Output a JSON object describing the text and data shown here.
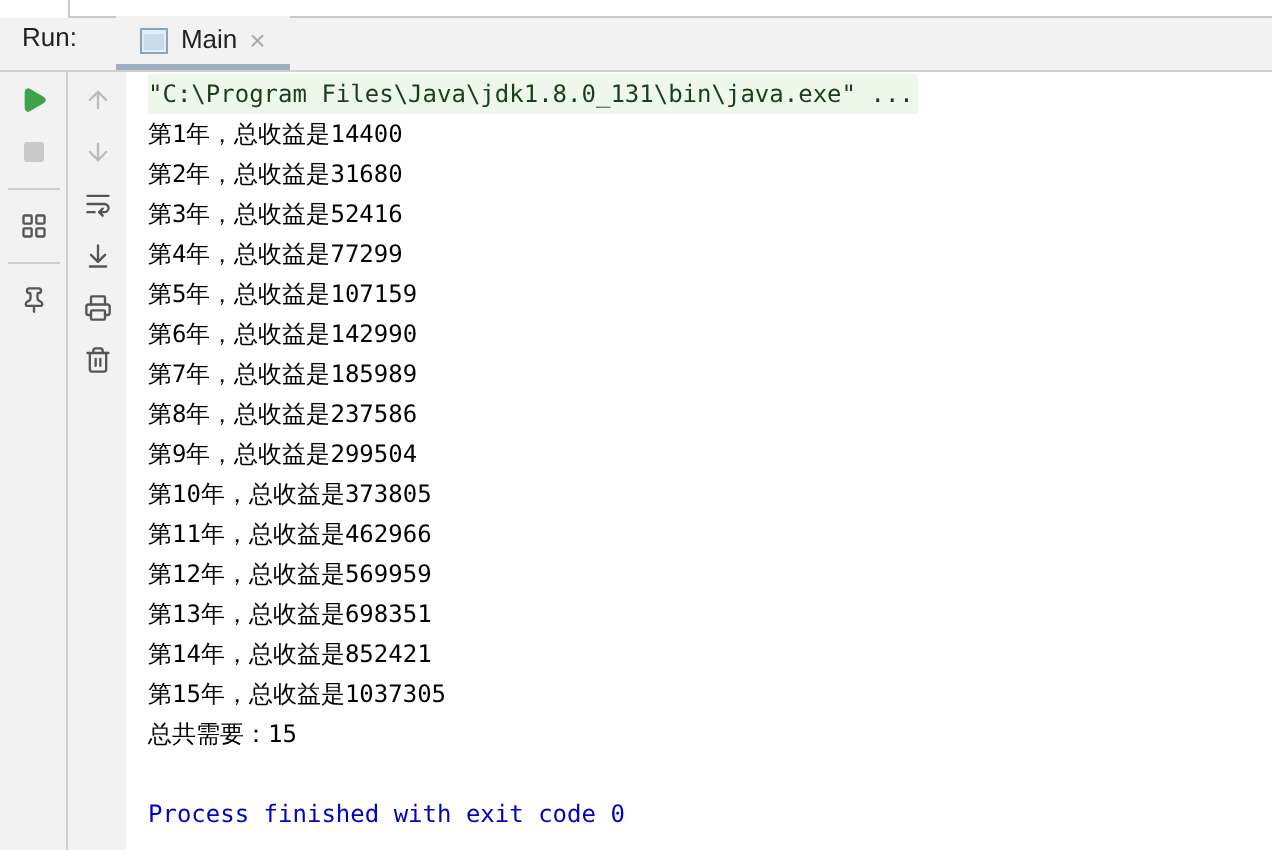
{
  "run_bar": {
    "label": "Run:",
    "tab": {
      "label": "Main",
      "selected": true,
      "close": "×"
    }
  },
  "console": {
    "command": "\"C:\\Program Files\\Java\\jdk1.8.0_131\\bin\\java.exe\" ...",
    "lines": [
      {
        "kind": "output",
        "text": "第1年，总收益是14400"
      },
      {
        "kind": "output",
        "text": "第2年，总收益是31680"
      },
      {
        "kind": "output",
        "text": "第3年，总收益是52416"
      },
      {
        "kind": "output",
        "text": "第4年，总收益是77299"
      },
      {
        "kind": "output",
        "text": "第5年，总收益是107159"
      },
      {
        "kind": "output",
        "text": "第6年，总收益是142990"
      },
      {
        "kind": "output",
        "text": "第7年，总收益是185989"
      },
      {
        "kind": "output",
        "text": "第8年，总收益是237586"
      },
      {
        "kind": "output",
        "text": "第9年，总收益是299504"
      },
      {
        "kind": "output",
        "text": "第10年，总收益是373805"
      },
      {
        "kind": "output",
        "text": "第11年，总收益是462966"
      },
      {
        "kind": "output",
        "text": "第12年，总收益是569959"
      },
      {
        "kind": "output",
        "text": "第13年，总收益是698351"
      },
      {
        "kind": "output",
        "text": "第14年，总收益是852421"
      },
      {
        "kind": "output",
        "text": "第15年，总收益是1037305"
      },
      {
        "kind": "output",
        "text": "总共需要：15"
      },
      {
        "kind": "blank"
      },
      {
        "kind": "system",
        "text": "Process finished with exit code 0"
      }
    ]
  }
}
